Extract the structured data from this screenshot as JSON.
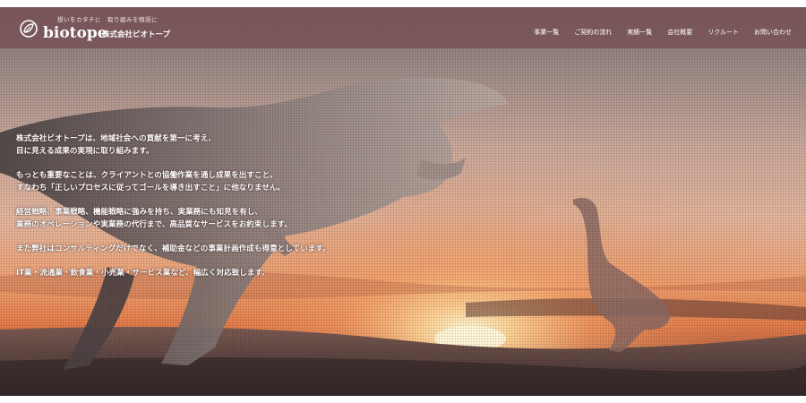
{
  "header": {
    "tagline": "想いをカタチに　取り組みを物語に",
    "brand": "biotope",
    "company": "株式会社ビオトープ"
  },
  "nav": {
    "items": [
      {
        "label": "事業一覧"
      },
      {
        "label": "ご契約の流れ"
      },
      {
        "label": "実績一覧"
      },
      {
        "label": "会社概要"
      },
      {
        "label": "リクルート"
      },
      {
        "label": "お問い合わせ"
      }
    ]
  },
  "intro": {
    "paragraphs": [
      {
        "lines": [
          "株式会社ビオトープは、地域社会への貢献を第一に考え、",
          "目に見える成果の実現に取り組みます。"
        ]
      },
      {
        "lines": [
          "もっとも重要なことは、クライアントとの協働作業を通し成果を出すこと。",
          "すなわち「正しいプロセスに従ってゴールを導き出すこと」に他なりません。"
        ]
      },
      {
        "lines": [
          "経営戦略、事業戦略、機能戦略に強みを持ち、実業務にも知見を有し、",
          "業務のオペレーションや実業務の代行まで、高品質なサービスをお約束します。"
        ]
      },
      {
        "lines": [
          "また弊社はコンサルティングだけでなく、補助金などの事業計画作成も得意としています。"
        ]
      },
      {
        "lines": [
          "IT業・流通業・飲食業・小売業・サービス業など、幅広く対応致します。"
        ]
      }
    ]
  },
  "colors": {
    "header_bg": "#785256",
    "sky_top": "#7d7273",
    "sun": "#fff2c8",
    "horizon": "#f7a56a"
  },
  "icons": {
    "logo_mark": "leaf-circle-icon"
  }
}
